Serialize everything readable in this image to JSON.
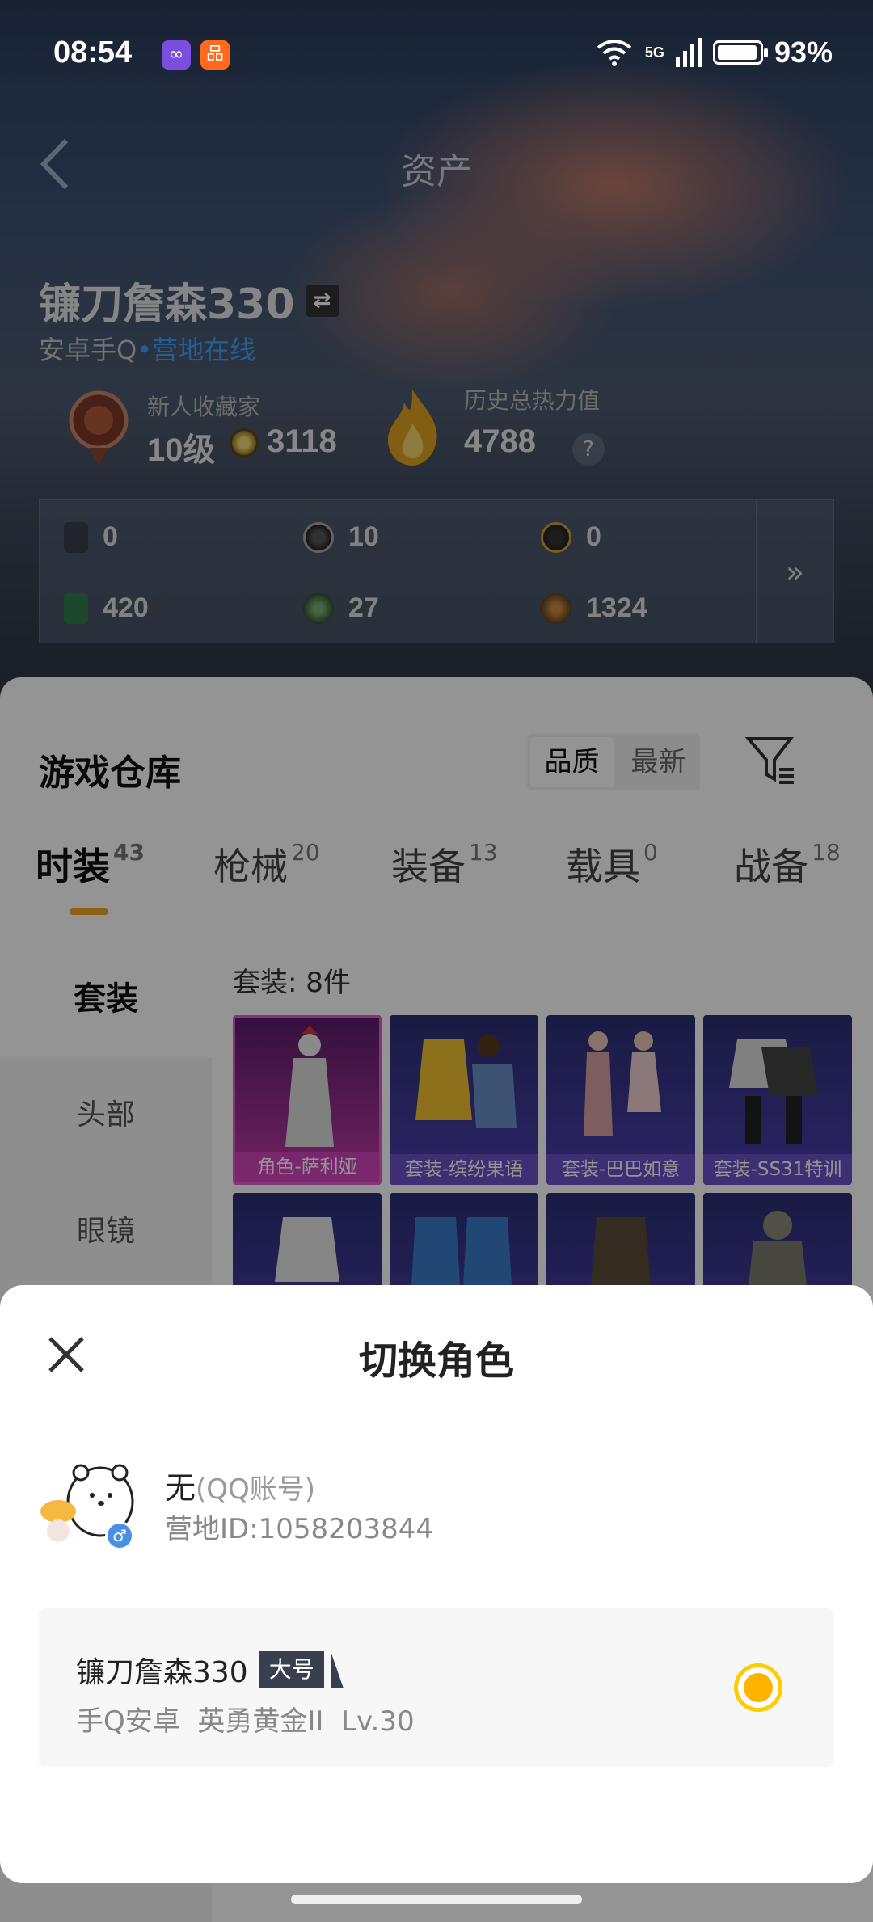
{
  "status_bar": {
    "time": "08:54",
    "network": "5G",
    "battery": "93%"
  },
  "header": {
    "title": "资产"
  },
  "profile": {
    "name": "镰刀詹森330",
    "platform": "安卓手Q",
    "dot": "•",
    "online_status": "营地在线",
    "collector_label": "新人收藏家",
    "collector_level": "10级",
    "collector_points": "3118",
    "heat_label": "历史总热力值",
    "heat_value": "4788",
    "help": "?"
  },
  "currencies": {
    "items": [
      {
        "value": "0",
        "icon": "card-icon"
      },
      {
        "value": "10",
        "icon": "silver-coin-icon"
      },
      {
        "value": "0",
        "icon": "gold-coin-icon"
      },
      {
        "value": "420",
        "icon": "green-ticket-icon"
      },
      {
        "value": "27",
        "icon": "green-coin-icon"
      },
      {
        "value": "1324",
        "icon": "bronze-coin-icon"
      }
    ],
    "more": "»"
  },
  "warehouse": {
    "title": "游戏仓库",
    "sort_quality": "品质",
    "sort_latest": "最新",
    "tabs": [
      {
        "label": "时装",
        "count": "43"
      },
      {
        "label": "枪械",
        "count": "20"
      },
      {
        "label": "装备",
        "count": "13"
      },
      {
        "label": "载具",
        "count": "0"
      },
      {
        "label": "战备",
        "count": "18"
      }
    ],
    "categories": [
      "套装",
      "头部",
      "眼镜"
    ],
    "suit_count": "套装: 8件",
    "items": [
      {
        "label": "角色-萨利娅"
      },
      {
        "label": "套装-缤纷果语"
      },
      {
        "label": "套装-巴巴如意"
      },
      {
        "label": "套装-SS31特训"
      },
      {
        "label": ""
      },
      {
        "label": ""
      },
      {
        "label": ""
      },
      {
        "label": ""
      }
    ]
  },
  "sheet": {
    "title": "切换角色",
    "account_name": "无",
    "account_type": "(QQ账号)",
    "account_id": "营地ID:1058203844",
    "gender": "♂",
    "role": {
      "name": "镰刀詹森330",
      "tag": "大号",
      "platform": "手Q安卓",
      "rank": "英勇黄金II",
      "level": "Lv.30"
    }
  },
  "colors": {
    "accent": "#f5a623",
    "radio": "#ffb300",
    "online": "#3fa4ff"
  }
}
